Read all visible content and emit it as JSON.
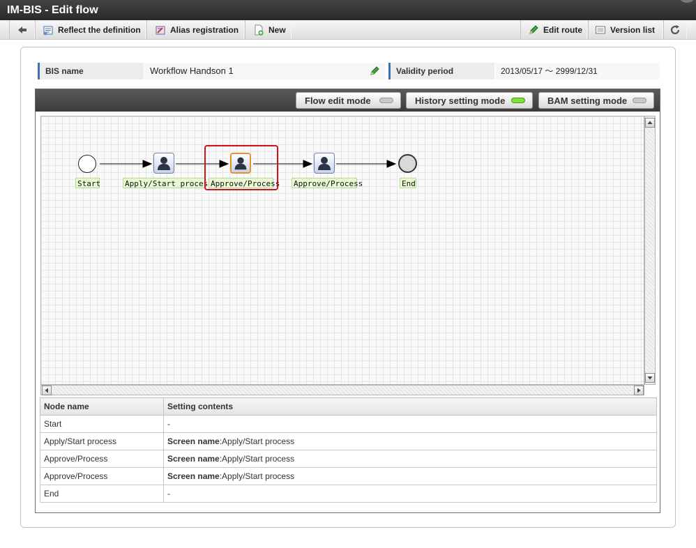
{
  "window": {
    "title": "IM-BIS - Edit flow"
  },
  "toolbar": {
    "back_icon": "arrow-left-icon",
    "reflect_label": "Reflect the definition",
    "alias_label": "Alias registration",
    "new_label": "New",
    "edit_route_label": "Edit route",
    "version_list_label": "Version list",
    "refresh_icon": "refresh-icon"
  },
  "info": {
    "bis_name_label": "BIS name",
    "bis_name_value": "Workflow Handson 1",
    "validity_label": "Validity period",
    "validity_value": "2013/05/17 ～ 2999/12/31"
  },
  "modes": {
    "flow_edit": {
      "label": "Flow edit mode",
      "active": false
    },
    "history": {
      "label": "History setting mode",
      "active": true
    },
    "bam": {
      "label": "BAM setting mode",
      "active": false
    }
  },
  "flow": {
    "nodes": [
      {
        "type": "start",
        "label": "Start"
      },
      {
        "type": "task",
        "label": "Apply/Start process"
      },
      {
        "type": "task",
        "label": "Approve/Process",
        "selected": true
      },
      {
        "type": "task",
        "label": "Approve/Process"
      },
      {
        "type": "end",
        "label": "End"
      }
    ],
    "selection_color": "#d0121b",
    "label_bg": "#e9f9d4"
  },
  "table": {
    "headers": [
      "Node name",
      "Setting contents"
    ],
    "screen_name_label": "Screen name",
    "rows": [
      {
        "node": "Start",
        "prefix": "",
        "value": "-"
      },
      {
        "node": "Apply/Start process",
        "prefix": "Screen name",
        "value": ":Apply/Start process"
      },
      {
        "node": "Approve/Process",
        "prefix": "Screen name",
        "value": ":Apply/Start process"
      },
      {
        "node": "Approve/Process",
        "prefix": "Screen name",
        "value": ":Apply/Start process"
      },
      {
        "node": "End",
        "prefix": "",
        "value": "-"
      }
    ]
  },
  "colors": {
    "accent": "#3b6fb0",
    "led_on": "#7ee03d"
  }
}
